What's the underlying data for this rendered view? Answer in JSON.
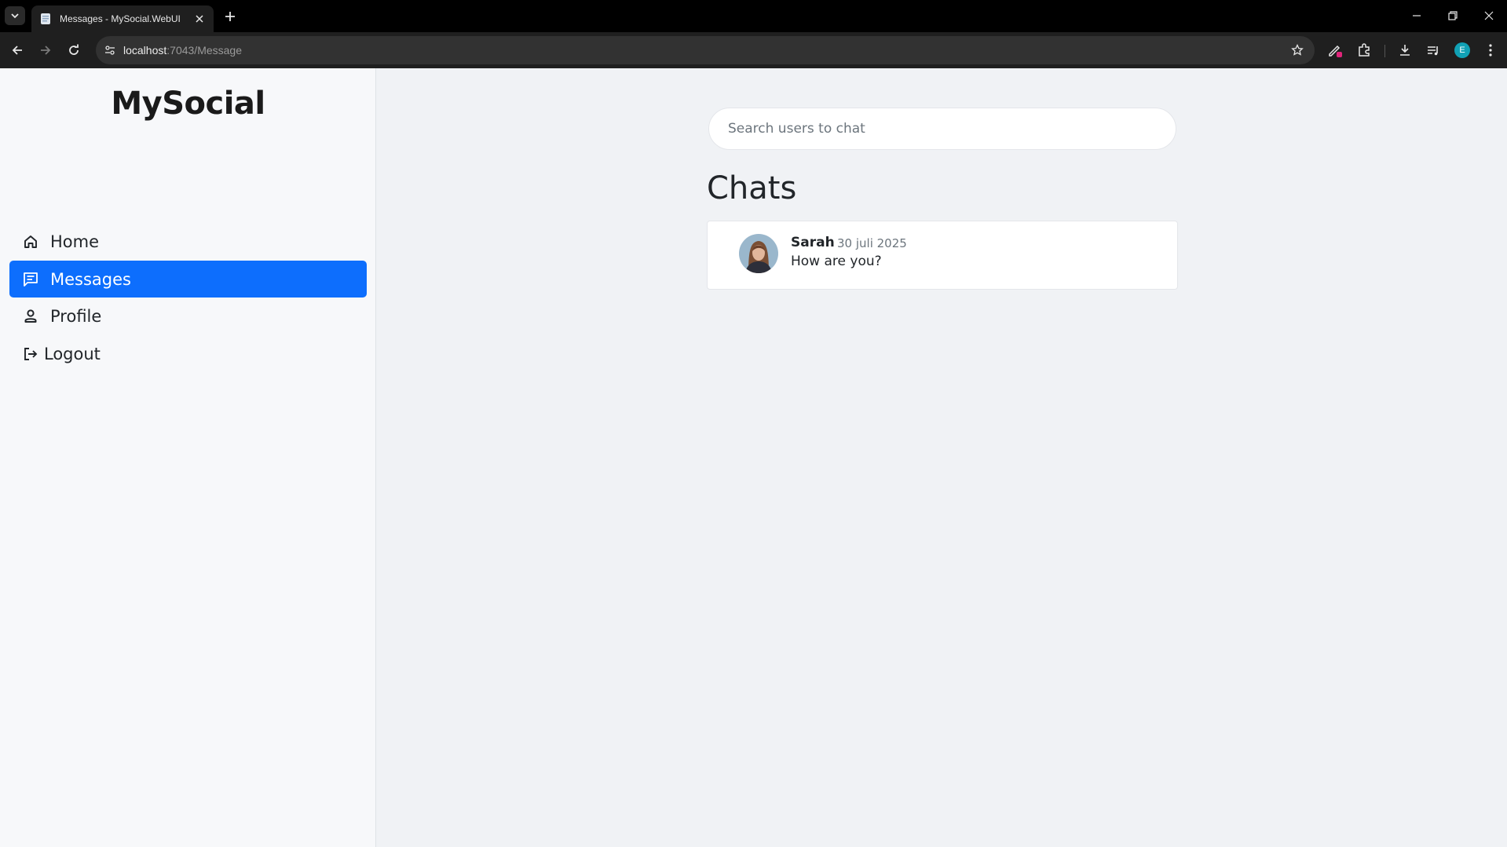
{
  "browser": {
    "tab_title": "Messages - MySocial.WebUI",
    "url_host": "localhost",
    "url_path": ":7043/Message",
    "profile_initial": "E"
  },
  "sidebar": {
    "brand": "MySocial",
    "items": [
      {
        "label": "Home",
        "icon": "home-icon",
        "active": false
      },
      {
        "label": "Messages",
        "icon": "chat-icon",
        "active": true
      },
      {
        "label": "Profile",
        "icon": "person-icon",
        "active": false
      },
      {
        "label": "Logout",
        "icon": "logout-icon",
        "active": false
      }
    ]
  },
  "main": {
    "search": {
      "placeholder": "Search users to chat",
      "value": ""
    },
    "title": "Chats",
    "chats": [
      {
        "name": "Sarah",
        "date": "30 juli 2025",
        "message": "How are you?"
      }
    ]
  },
  "colors": {
    "accent": "#0d6efd",
    "page_bg": "#f0f2f5",
    "sidebar_bg": "#f7f8fa"
  }
}
